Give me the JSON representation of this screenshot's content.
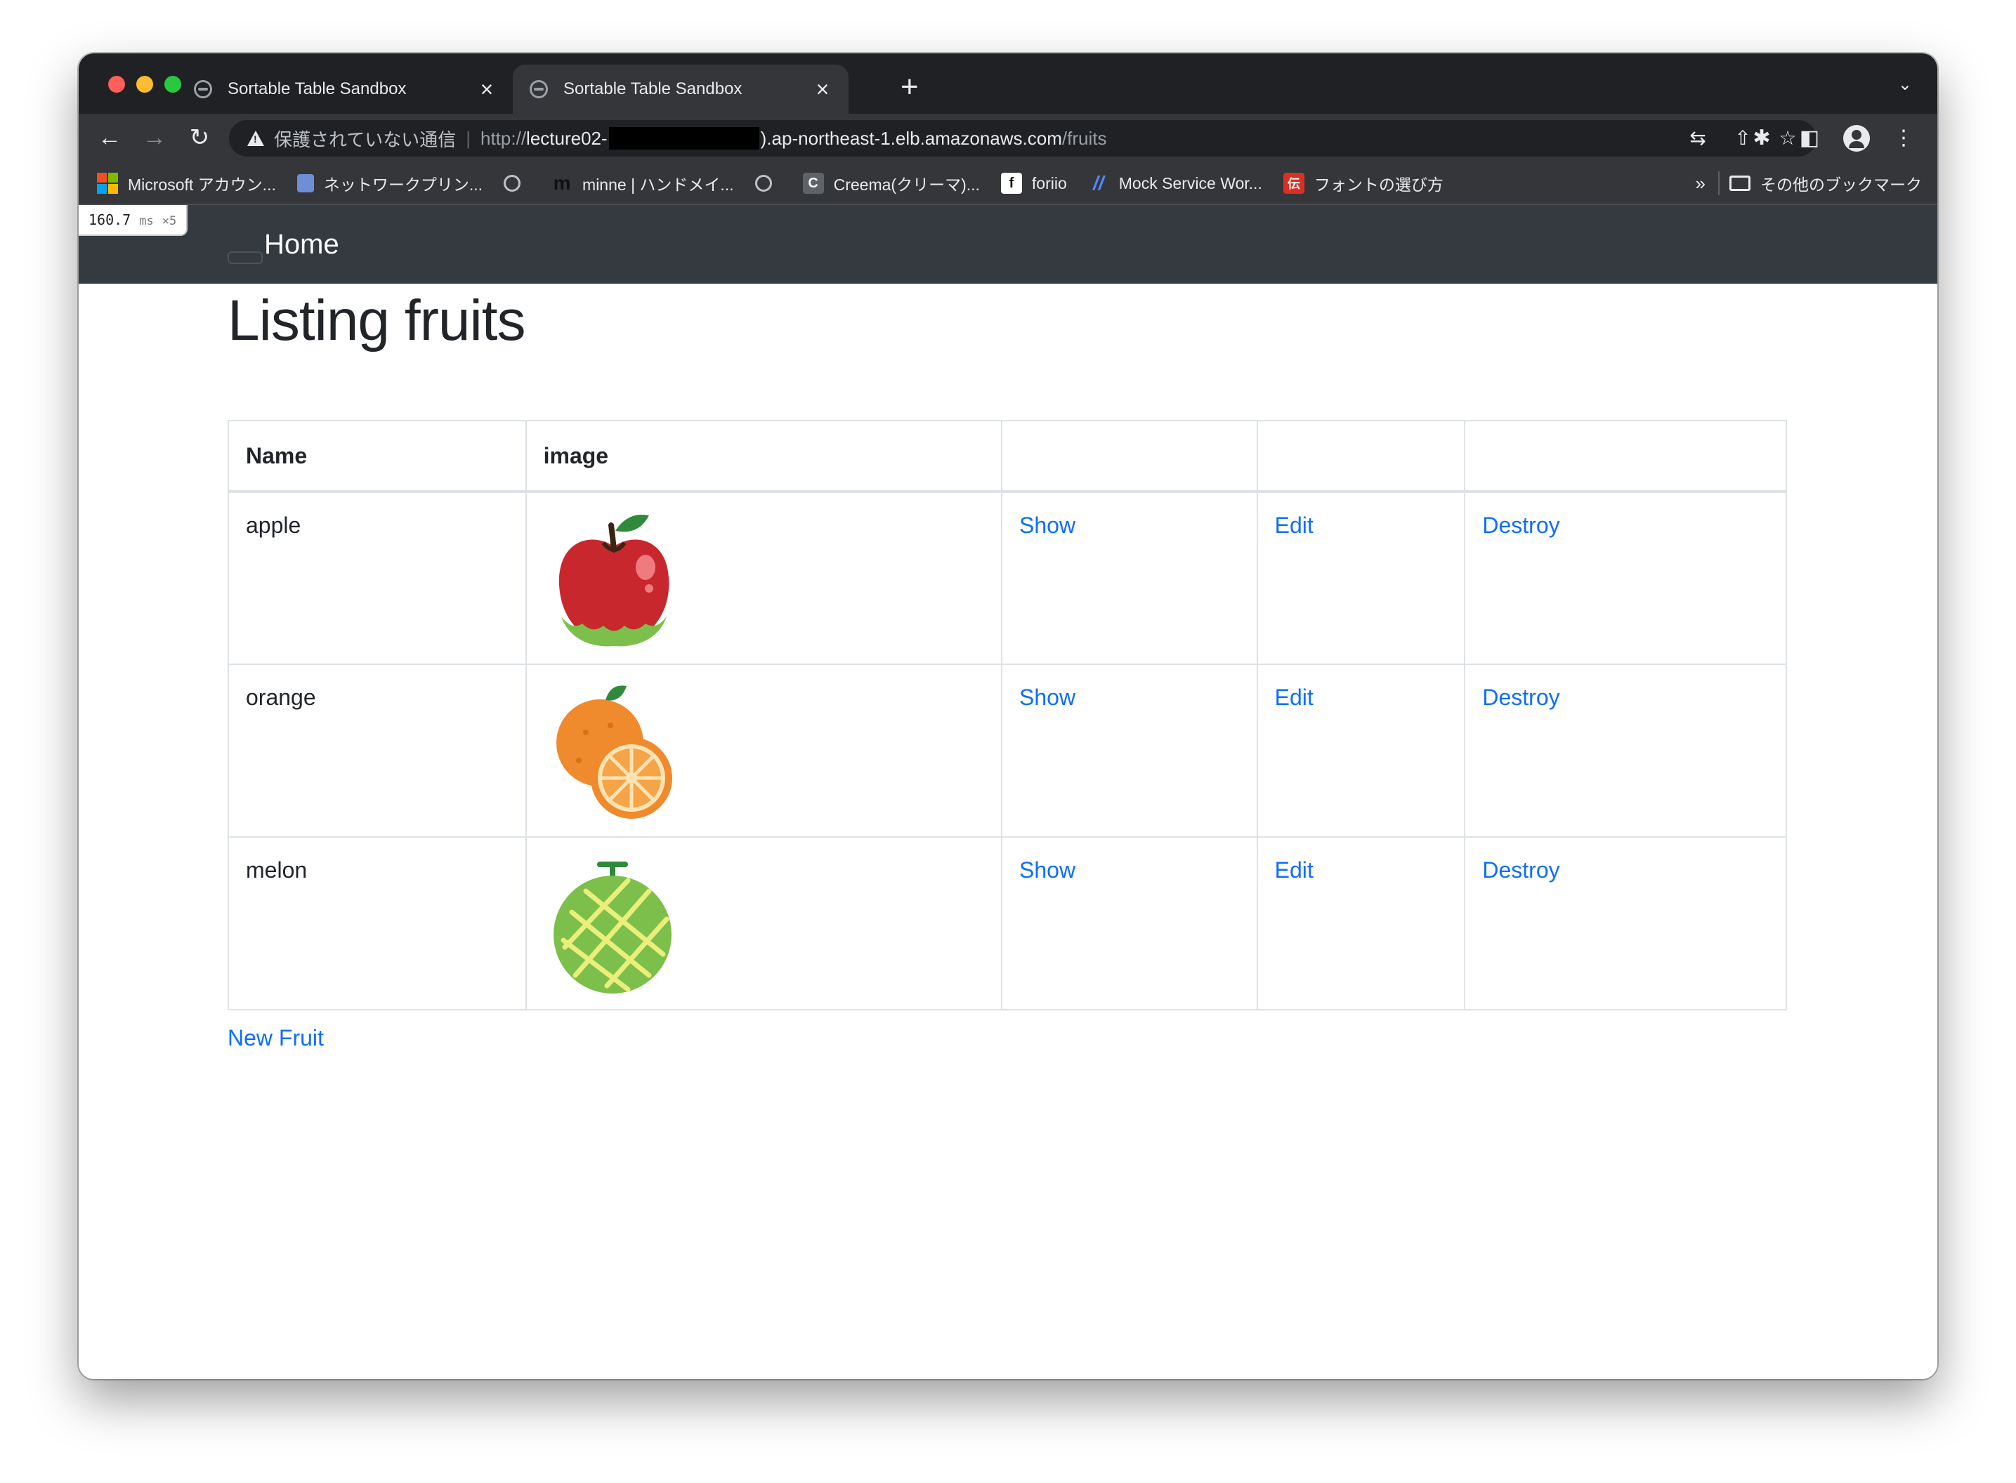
{
  "browser": {
    "tabs": [
      {
        "title": "Sortable Table Sandbox",
        "active": false
      },
      {
        "title": "Sortable Table Sandbox",
        "active": true
      }
    ],
    "address": {
      "security_label": "保護されていない通信",
      "scheme": "http://",
      "host_prefix": "lecture02-",
      "host_suffix": ").ap-northeast-1.elb.amazonaws.com",
      "path": "/fruits"
    },
    "bookmarks": [
      {
        "label": "Microsoft アカウン...",
        "icon": "microsoft-icon"
      },
      {
        "label": "ネットワークプリン...",
        "icon": "printer-icon"
      },
      {
        "label": "",
        "icon": "globe-icon"
      },
      {
        "label": "minne | ハンドメイ...",
        "icon": "minne-icon",
        "icon_text": "m"
      },
      {
        "label": "",
        "icon": "globe-icon"
      },
      {
        "label": "Creema(クリーマ)...",
        "icon": "creema-icon",
        "icon_text": "C"
      },
      {
        "label": "foriio",
        "icon": "foriio-icon",
        "icon_text": "f"
      },
      {
        "label": "Mock Service Wor...",
        "icon": "msw-icon"
      },
      {
        "label": "フォントの選び方",
        "icon": "font-icon",
        "icon_text": "伝"
      }
    ],
    "bookmarks_more": "»",
    "other_bookmarks": "その他のブックマーク",
    "colors": {
      "chrome_dark": "#202124",
      "chrome_toolbar": "#35363a"
    }
  },
  "perf_badge": {
    "value": "160.7",
    "unit": "ms",
    "multiplier": "×5"
  },
  "navbar": {
    "brand": "Home"
  },
  "page": {
    "title": "Listing fruits",
    "table": {
      "headers": [
        "Name",
        "image",
        "",
        "",
        ""
      ],
      "rows": [
        {
          "name": "apple",
          "image": "apple-image",
          "show": "Show",
          "edit": "Edit",
          "destroy": "Destroy"
        },
        {
          "name": "orange",
          "image": "orange-image",
          "show": "Show",
          "edit": "Edit",
          "destroy": "Destroy"
        },
        {
          "name": "melon",
          "image": "melon-image",
          "show": "Show",
          "edit": "Edit",
          "destroy": "Destroy"
        }
      ]
    },
    "new_link": "New Fruit",
    "colors": {
      "link": "#0d6efd",
      "navbar": "#343a40",
      "border": "#dee2e6"
    }
  }
}
